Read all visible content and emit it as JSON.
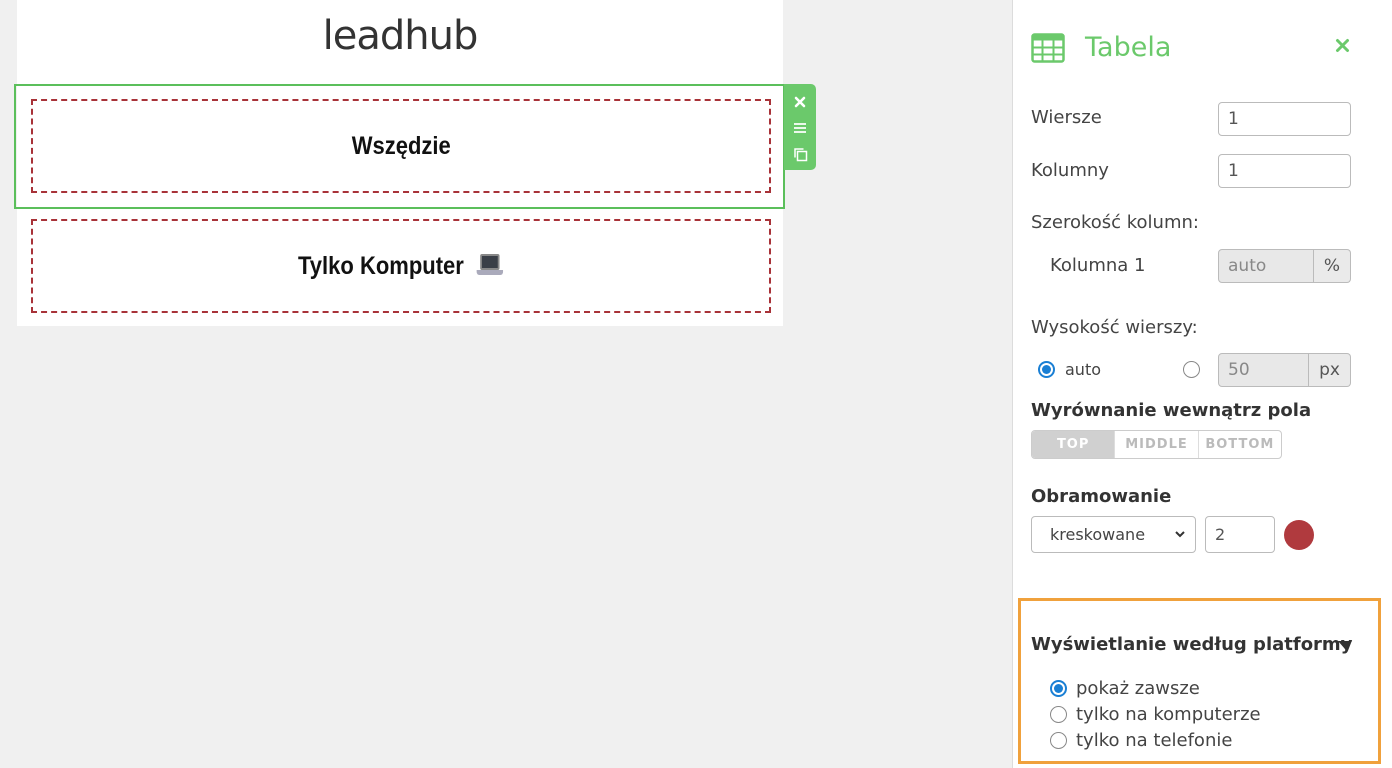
{
  "canvas": {
    "logo": "leadhub",
    "blocks": [
      {
        "label": "Wszędzie"
      },
      {
        "label": "Tylko Komputer"
      }
    ]
  },
  "panel": {
    "title": "Tabela",
    "rows_label": "Wiersze",
    "rows_value": "1",
    "cols_label": "Kolumny",
    "cols_value": "1",
    "col_width_label": "Szerokość kolumn:",
    "col1_label": "Kolumna 1",
    "col1_value": "auto",
    "col1_unit": "%",
    "row_height_label": "Wysokość wierszy:",
    "row_height_auto_label": "auto",
    "row_height_value": "50",
    "row_height_unit": "px",
    "align_label": "Wyrównanie wewnątrz pola",
    "align_options": [
      "TOP",
      "MIDDLE",
      "BOTTOM"
    ],
    "align_selected": "TOP",
    "border_label": "Obramowanie",
    "border_style": "kreskowane",
    "border_width": "2",
    "border_color": "#b03a3e",
    "platform_label": "Wyświetlanie według platformy",
    "platform_options": [
      "pokaż zawsze",
      "tylko na komputerze",
      "tylko na telefonie"
    ],
    "platform_selected": "pokaż zawsze"
  },
  "colors": {
    "accent": "#6bc96b",
    "highlight": "#f0a13c",
    "dashed_border": "#a83238",
    "radio_selected": "#1a7fd4"
  }
}
